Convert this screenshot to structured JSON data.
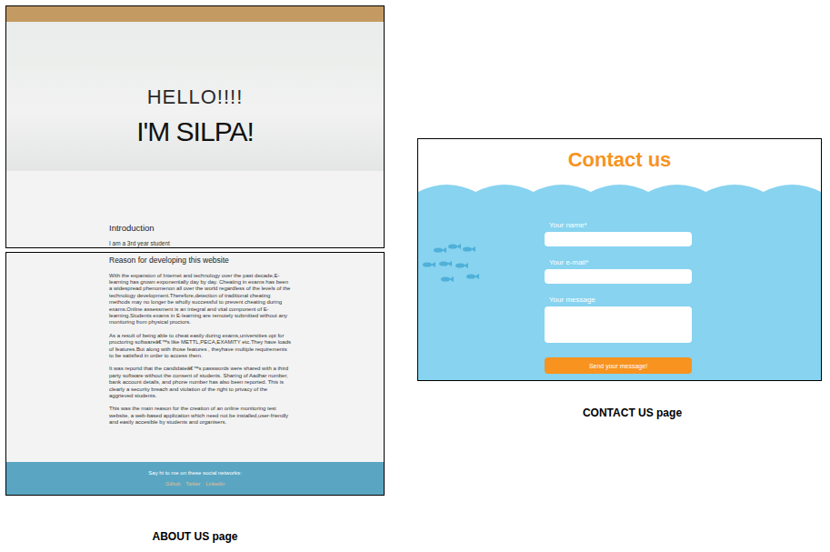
{
  "about_page": {
    "hero": {
      "greeting": "HELLO!!!!",
      "name": "I'M SILPA!"
    },
    "introduction": {
      "heading": "Introduction",
      "text": "I am a 3rd year student"
    },
    "reason": {
      "heading": "Reason for developing this website",
      "paragraphs": [
        "With the expansion of Internet and technology over the past decade,E-learning has grown exponentially day by day. Cheating in exams has been a widespread phenomenon all over the world regardless of the levels of the technology development.Therefore,detection of traditional cheating methods may no longer be wholly successful to prevent cheating during exams.Online assessment is an integral and vital component of E-learning.Students exams in E-learning are remotely submitted without any monitoring from physical proctors.",
        "As a result of being able to cheat easily during exams,universities opt for proctoring softwareâ€™s like METTL,PECA,EXAMITY etc.They have loads of features.But along with those features , theyhave multiple requirements to be satisfied in order to access them.",
        "It was reportd that the candidateâ€™s passwords were shared with a third party software without the consent of students. Sharing of Aadhar number, bank account details, and phone number has also been reported. This is clearly a security breach and violation of the right to privacy of the aggrieved students.",
        "This was the main reason for the creation of an online monitoring test website, a web-based application which need not be installed,user-friendly and easily accesible by students and organisers."
      ]
    },
    "footer": {
      "text": "Say hi to me on these social networks:",
      "links": [
        "Github",
        "Twitter",
        "Linkedin"
      ]
    }
  },
  "contact_page": {
    "title": "Contact us",
    "fields": [
      {
        "label": "Your name*",
        "kind": "input"
      },
      {
        "label": "Your e-mail*",
        "kind": "input"
      },
      {
        "label": "Your message",
        "kind": "textarea"
      }
    ],
    "button": "Send your message!"
  },
  "captions": {
    "about": "ABOUT US page",
    "contact": "CONTACT US page"
  }
}
